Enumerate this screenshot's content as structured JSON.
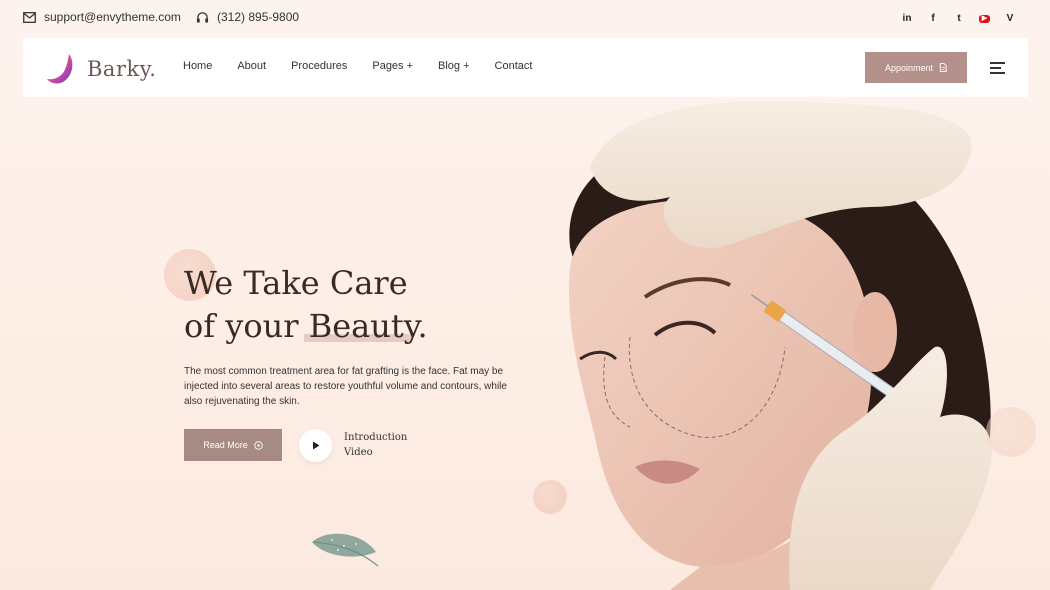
{
  "topbar": {
    "email": "support@envytheme.com",
    "phone": "(312) 895-9800",
    "social": [
      {
        "icon": "linkedin-icon",
        "label": "in"
      },
      {
        "icon": "facebook-icon",
        "label": "f"
      },
      {
        "icon": "twitter-icon",
        "label": "t"
      },
      {
        "icon": "youtube-icon",
        "label": "▶"
      },
      {
        "icon": "vimeo-icon",
        "label": "V"
      }
    ]
  },
  "nav": {
    "logo": "Barky.",
    "items": [
      "Home",
      "About",
      "Procedures",
      "Pages +",
      "Blog +",
      "Contact"
    ],
    "appointment_label": "Appoinment"
  },
  "hero": {
    "title_line1": "We Take Care",
    "title_line2": "of your Beauty.",
    "description": "The most common treatment area for fat grafting is the face. Fat may be injected into several areas to restore youthful volume and contours, while also rejuvenating the skin.",
    "read_more_label": "Read More",
    "video_label_line1": "Introduction",
    "video_label_line2": "Video"
  },
  "colors": {
    "accent": "#b3918a",
    "background": "#fdf0e8",
    "heading": "#3a2a26"
  }
}
